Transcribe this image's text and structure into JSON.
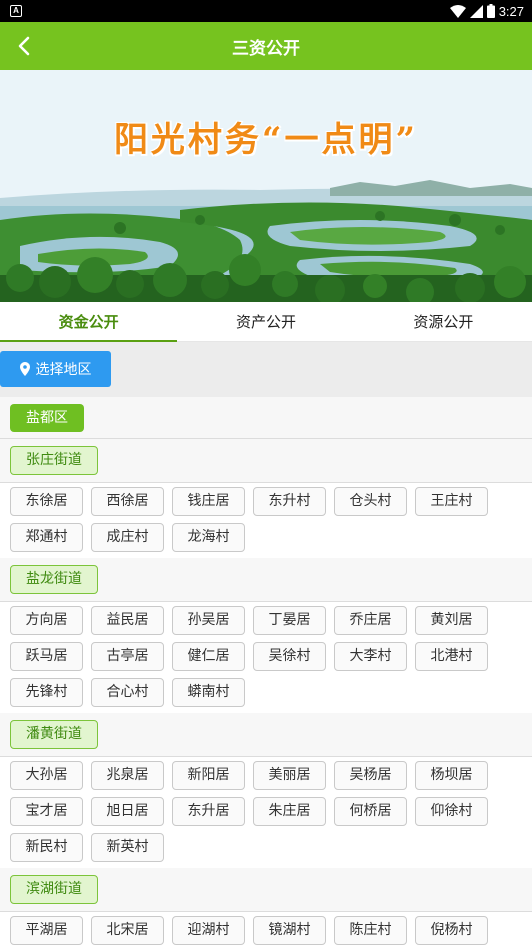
{
  "status_bar": {
    "time": "3:27",
    "notification_letter": "A"
  },
  "header": {
    "title": "三资公开"
  },
  "banner": {
    "title": "阳光村务“一点明”"
  },
  "tabs": [
    {
      "label": "资金公开",
      "active": true
    },
    {
      "label": "资产公开",
      "active": false
    },
    {
      "label": "资源公开",
      "active": false
    }
  ],
  "region": {
    "button_label": "选择地区"
  },
  "district": {
    "name": "盐都区"
  },
  "streets": [
    {
      "name": "张庄街道",
      "villages": [
        "东徐居",
        "西徐居",
        "钱庄居",
        "东升村",
        "仓头村",
        "王庄村",
        "郑通村",
        "成庄村",
        "龙海村"
      ]
    },
    {
      "name": "盐龙街道",
      "villages": [
        "方向居",
        "益民居",
        "孙吴居",
        "丁晏居",
        "乔庄居",
        "黄刘居",
        "跃马居",
        "古亭居",
        "健仁居",
        "吴徐村",
        "大李村",
        "北港村",
        "先锋村",
        "合心村",
        "蟒南村"
      ]
    },
    {
      "name": "潘黄街道",
      "villages": [
        "大孙居",
        "兆泉居",
        "新阳居",
        "美丽居",
        "吴杨居",
        "杨坝居",
        "宝才居",
        "旭日居",
        "东升居",
        "朱庄居",
        "何桥居",
        "仰徐村",
        "新民村",
        "新英村"
      ]
    },
    {
      "name": "滨湖街道",
      "villages": [
        "平湖居",
        "北宋居",
        "迎湖村",
        "镜湖村",
        "陈庄村",
        "倪杨村"
      ]
    }
  ],
  "colors": {
    "primary_green": "#76c31f",
    "region_button_blue": "#2e9af0",
    "banner_title_orange": "#f08a16"
  }
}
